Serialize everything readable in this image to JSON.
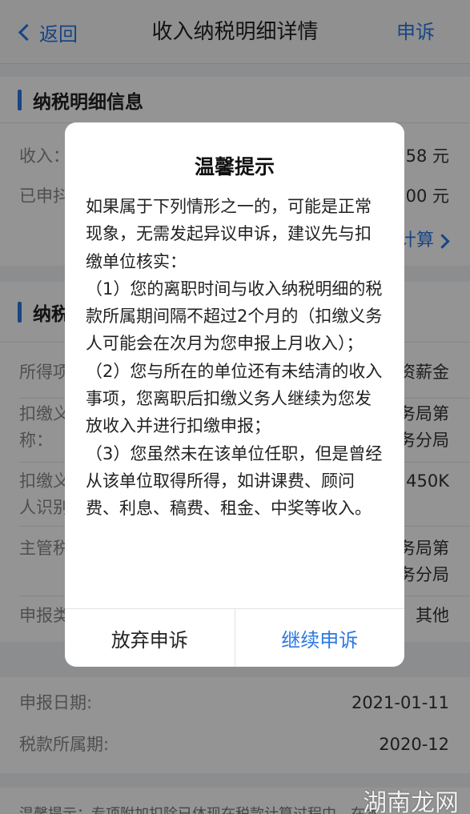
{
  "navbar": {
    "back_label": "返回",
    "title": "收入纳税明细详情",
    "appeal_label": "申诉"
  },
  "section1": {
    "title": "纳税明细信息",
    "income_label": "收入：",
    "income_value_partial": "58 元",
    "declared_label_partial": "已申抖",
    "declared_value_partial": "00 元",
    "calc_link_partial": "计算"
  },
  "section2": {
    "title_partial": "纳税",
    "rows": [
      {
        "label": "所得项",
        "value": "资薪金"
      },
      {
        "label": "扣缴义",
        "label2": "称：",
        "value": "务局第",
        "value2": "务分局"
      },
      {
        "label": "扣缴义",
        "label2": "人识别",
        "value": "450K"
      },
      {
        "label": "主管税",
        "value": "务局第",
        "value2": "务分局"
      },
      {
        "label": "申报类",
        "value": "其他"
      }
    ]
  },
  "section3": {
    "report_date_label": "申报日期:",
    "report_date_value": "2021-01-11",
    "tax_period_label": "税款所属期:",
    "tax_period_value": "2020-12"
  },
  "footer_tip": "温馨提示：专项附加扣除已体现在税款计算过程中，在本",
  "watermark": "湖南龙网",
  "dialog": {
    "title": "温馨提示",
    "paragraphs": [
      "如果属于下列情形之一的，可能是正常现象，无需发起异议申诉，建议先与扣缴单位核实：",
      "（1）您的离职时间与收入纳税明细的税款所属期间隔不超过2个月的（扣缴义务人可能会在次月为您申报上月收入）；",
      "（2）您与所在的单位还有未结清的收入事项，您离职后扣缴义务人继续为您发放收入并进行扣缴申报；",
      "（3）您虽然未在该单位任职，但是曾经从该单位取得所得，如讲课费、顾问费、利息、稿费、租金、中奖等收入。"
    ],
    "cancel_label": "放弃申诉",
    "continue_label": "继续申诉"
  }
}
